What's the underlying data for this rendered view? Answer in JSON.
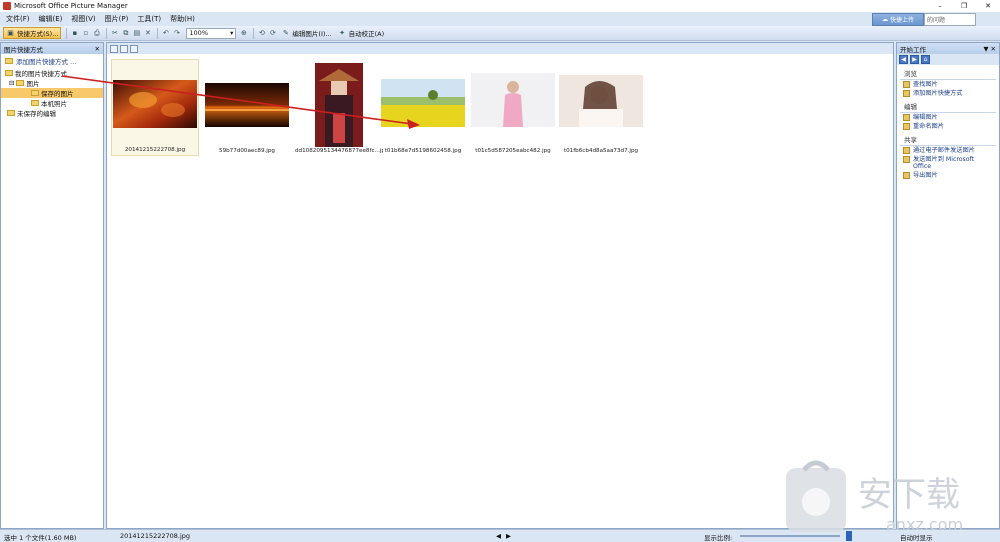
{
  "window": {
    "title": "Microsoft Office Picture Manager",
    "min": "–",
    "max": "❐",
    "close": "✕"
  },
  "menu": [
    "文件(F)",
    "编辑(E)",
    "视图(V)",
    "图片(P)",
    "工具(T)",
    "帮助(H)"
  ],
  "help": {
    "button_label": "快捷上传",
    "placeholder": "的问题"
  },
  "toolbar": {
    "shortcuts_label": "快捷方式(S)...",
    "zoom_value": "100%",
    "edit_label": "编辑图片(I)...",
    "autofix_label": "自动校正(A)"
  },
  "left_pane": {
    "title": "图片快捷方式",
    "add_link": "添加图片快捷方式 ...",
    "root": "我的图片快捷方式",
    "tree": [
      {
        "label": "图片",
        "indent": 1
      },
      {
        "label": "保存的图片",
        "indent": 2,
        "selected": true
      },
      {
        "label": "本机照片",
        "indent": 2
      }
    ],
    "unsaved": "未保存的编辑"
  },
  "thumbnails": [
    {
      "filename": "20141215222708.jpg",
      "selected": true
    },
    {
      "filename": "59b77d00aec89.jpg"
    },
    {
      "filename": "dd1082095134476877ee8fc...jpg"
    },
    {
      "filename": "t01b68e7d5198602458.jpg"
    },
    {
      "filename": "t01c5d587205eabc482.jpg"
    },
    {
      "filename": "t01fb6cb4d8a5aa73d7.jpg"
    }
  ],
  "right_pane": {
    "title": "开始工作",
    "sections": [
      {
        "name": "浏览",
        "items": [
          "查找图片",
          "添加图片快捷方式"
        ]
      },
      {
        "name": "编辑",
        "items": [
          "编辑图片",
          "重命名图片"
        ]
      },
      {
        "name": "共享",
        "items": [
          "通过电子邮件发送图片",
          "发送图片到 Microsoft Office",
          "导出图片"
        ]
      }
    ]
  },
  "status": {
    "left": "选中 1 个文件(1.60 MB)",
    "file": "20141215222708.jpg",
    "zoom_label": "显示比例:",
    "right": "自动时显示"
  },
  "colors": {
    "accent": "#2e64b8",
    "arrow": "#cc1f1f",
    "selected": "#f8c96a"
  }
}
